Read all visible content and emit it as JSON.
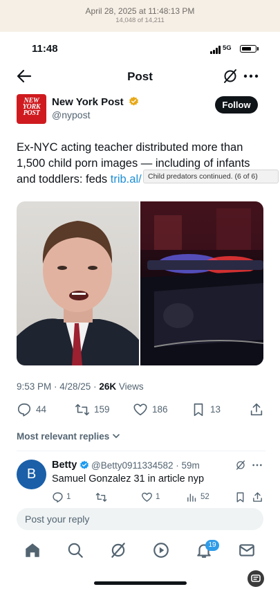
{
  "viewer": {
    "date": "April 28, 2025 at 11:48:13 PM",
    "count": "14,048 of 14,211"
  },
  "status_bar": {
    "time": "11:48",
    "network": "5G",
    "battery_level": 0.75
  },
  "nav": {
    "title": "Post",
    "back_icon": "arrow-left-icon",
    "grok_icon": "grok-icon",
    "more_icon": "more-icon"
  },
  "author": {
    "logo_line1": "NEW",
    "logo_line2": "YORK",
    "logo_line3": "POST",
    "name": "New York Post",
    "handle": "@nypost",
    "follow_label": "Follow",
    "verified_color": "#e8a918"
  },
  "tweet": {
    "text": "Ex-NYC acting teacher distributed more than 1,500 child porn images — including of infants and toddlers: feds ",
    "link": "trib.al/",
    "tooltip": "Child predators continued.  (6 of 6)"
  },
  "meta": {
    "time": "9:53 PM · 4/28/25 · ",
    "views_count": "26K",
    "views_label": " Views"
  },
  "actions": {
    "replies": "44",
    "reposts": "159",
    "likes": "186",
    "bookmarks": "13"
  },
  "replies_sort_label": "Most relevant replies",
  "reply": {
    "avatar_letter": "B",
    "name": "Betty",
    "handle_time": "@Betty0911334582 · 59m",
    "text": "Samuel Gonzalez 31 in article nyp",
    "reply_count": "1",
    "repost_count": "",
    "like_count": "1",
    "views_count": "52"
  },
  "reply_input": {
    "placeholder": "Post your reply"
  },
  "tabbar": {
    "tabs": [
      "home-icon",
      "search-icon",
      "grok-icon",
      "video-icon",
      "notifications-icon",
      "messages-icon"
    ],
    "notifications_badge": "19"
  },
  "colors": {
    "accent": "#1d9bf0",
    "nypost_red": "#cf1b1f",
    "badge_blue": "#2f9ce8"
  }
}
